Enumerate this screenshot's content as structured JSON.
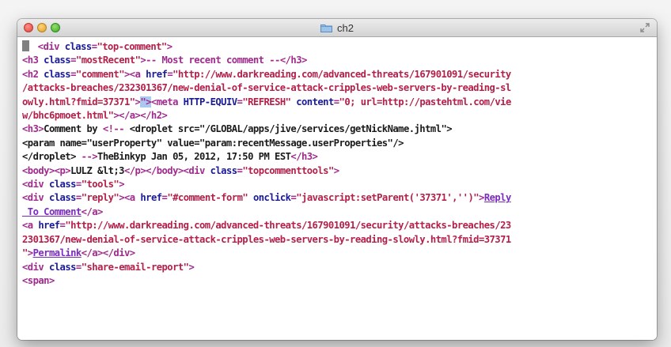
{
  "window": {
    "title": "ch2",
    "traffic_lights": [
      "close",
      "minimize",
      "zoom"
    ],
    "icon": "folder-icon"
  },
  "colors": {
    "tag": "#a02a8e",
    "attribute": "#1a1a9a",
    "string": "#b3204a",
    "text": "#1a1a1a",
    "link": "#7c2bbf",
    "selection": "#aac8f0"
  },
  "lines": [
    [
      [
        "t",
        " <div "
      ],
      [
        "a",
        "class"
      ],
      [
        "t",
        "="
      ],
      [
        "s",
        "\"top-comment\""
      ],
      [
        "t",
        ">"
      ]
    ],
    [
      [
        "t",
        "<h3 "
      ],
      [
        "a",
        "class"
      ],
      [
        "t",
        "="
      ],
      [
        "s",
        "\"mostRecent\""
      ],
      [
        "t",
        ">-- Most recent comment --</h3>"
      ]
    ],
    [
      [
        "t",
        "<h2 "
      ],
      [
        "a",
        "class"
      ],
      [
        "t",
        "="
      ],
      [
        "s",
        "\"comment\""
      ],
      [
        "t",
        "><a "
      ],
      [
        "a",
        "href"
      ],
      [
        "t",
        "="
      ],
      [
        "s",
        "\"http://www.darkreading.com/advanced-threats/167901091/security"
      ]
    ],
    [
      [
        "s",
        "/attacks-breaches/232301367/new-denial-of-service-attack-cripples-web-servers-by-reading-sl"
      ]
    ],
    [
      [
        "s",
        "owly.html?fmid=37371\""
      ],
      [
        "t",
        ">"
      ],
      [
        "hl",
        "\">"
      ],
      [
        "t",
        "<meta "
      ],
      [
        "a",
        "HTTP-EQUIV"
      ],
      [
        "t",
        "="
      ],
      [
        "s",
        "\"REFRESH\""
      ],
      [
        "t",
        " "
      ],
      [
        "a",
        "content"
      ],
      [
        "t",
        "="
      ],
      [
        "s",
        "\"0; url=http://pastehtml.com/vie"
      ]
    ],
    [
      [
        "s",
        "w/bhc6pmoet.html\""
      ],
      [
        "t",
        "></a></h2>"
      ]
    ],
    [
      [
        "t",
        "<h3>"
      ],
      [
        "x",
        "Comment by "
      ],
      [
        "t",
        "<!-- "
      ],
      [
        "x",
        "<droplet src=\"/GLOBAL/apps/jive/services/getNickName.jhtml\">"
      ]
    ],
    [
      [
        "x",
        "<param name=\"userProperty\" value=\"param:recentMessage.userProperties\"/>"
      ]
    ],
    [
      [
        "x",
        "</droplet> "
      ],
      [
        "t",
        "-->"
      ],
      [
        "x",
        "TheBinkyp Jan 05, 2012, 17:50 PM EST"
      ],
      [
        "t",
        "</h3>"
      ]
    ],
    [
      [
        "t",
        "<body><p>"
      ],
      [
        "x",
        "LULZ &lt;3"
      ],
      [
        "t",
        "</p></body><div "
      ],
      [
        "a",
        "class"
      ],
      [
        "t",
        "="
      ],
      [
        "s",
        "\"topcommenttools\""
      ],
      [
        "t",
        ">"
      ]
    ],
    [
      [
        "t",
        "<div "
      ],
      [
        "a",
        "class"
      ],
      [
        "t",
        "="
      ],
      [
        "s",
        "\"tools\""
      ],
      [
        "t",
        ">"
      ]
    ],
    [
      [
        "t",
        "<div "
      ],
      [
        "a",
        "class"
      ],
      [
        "t",
        "="
      ],
      [
        "s",
        "\"reply\""
      ],
      [
        "t",
        "><a "
      ],
      [
        "a",
        "href"
      ],
      [
        "t",
        "="
      ],
      [
        "s",
        "\"#comment-form\""
      ],
      [
        "t",
        " "
      ],
      [
        "a",
        "onclick"
      ],
      [
        "t",
        "="
      ],
      [
        "s",
        "\"javascript:setParent('37371','')\""
      ],
      [
        "t",
        ">"
      ],
      [
        "u",
        "Reply"
      ]
    ],
    [
      [
        "u",
        " To Comment"
      ],
      [
        "t",
        "</a>"
      ]
    ],
    [
      [
        "t",
        "<a "
      ],
      [
        "a",
        "href"
      ],
      [
        "t",
        "="
      ],
      [
        "s",
        "\"http://www.darkreading.com/advanced-threats/167901091/security/attacks-breaches/23"
      ]
    ],
    [
      [
        "s",
        "2301367/new-denial-of-service-attack-cripples-web-servers-by-reading-slowly.html?fmid=37371"
      ]
    ],
    [
      [
        "s",
        "\""
      ],
      [
        "t",
        ">"
      ],
      [
        "u",
        "Permalink"
      ],
      [
        "t",
        "</a></div>"
      ]
    ],
    [
      [
        "t",
        "<div "
      ],
      [
        "a",
        "class"
      ],
      [
        "t",
        "="
      ],
      [
        "s",
        "\"share-email-report\""
      ],
      [
        "t",
        ">"
      ]
    ],
    [
      [
        "t",
        "<span>"
      ]
    ]
  ]
}
